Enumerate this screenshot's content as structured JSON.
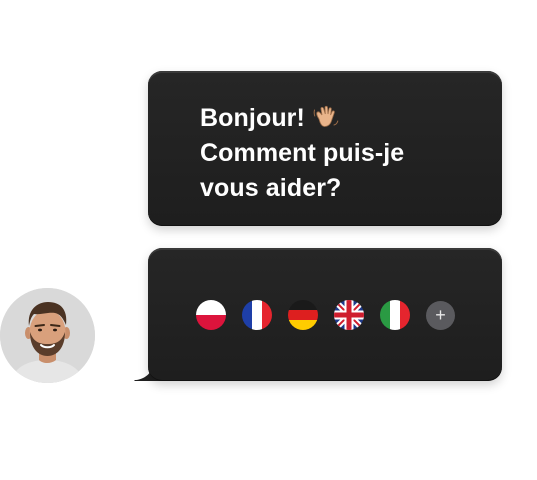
{
  "message": {
    "lines": [
      "Bonjour!",
      "Comment puis-je",
      "vous aider?"
    ],
    "emoji": "waving-hand"
  },
  "languages": [
    {
      "name": "Polish",
      "icon": "poland-flag-icon"
    },
    {
      "name": "French",
      "icon": "france-flag-icon"
    },
    {
      "name": "German",
      "icon": "germany-flag-icon"
    },
    {
      "name": "English (UK)",
      "icon": "uk-flag-icon"
    },
    {
      "name": "Italian",
      "icon": "italy-flag-icon"
    }
  ],
  "more_label": "+",
  "colors": {
    "bubble": "#232323",
    "text": "#ffffff",
    "more_button": "#5a5a5e"
  }
}
